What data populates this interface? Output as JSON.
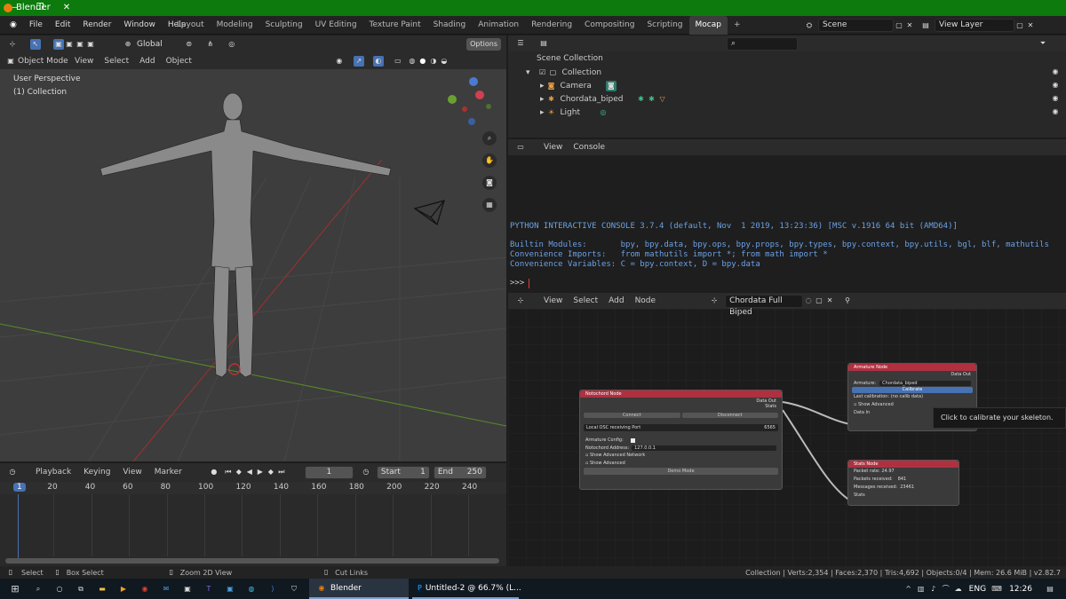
{
  "window": {
    "title": "Blender",
    "min": "—",
    "max": "❐",
    "close": "✕"
  },
  "menus": [
    "File",
    "Edit",
    "Render",
    "Window",
    "Help"
  ],
  "workspaces": [
    "Layout",
    "Modeling",
    "Sculpting",
    "UV Editing",
    "Texture Paint",
    "Shading",
    "Animation",
    "Rendering",
    "Compositing",
    "Scripting",
    "Mocap"
  ],
  "active_workspace": "Mocap",
  "scene": "Scene",
  "view_layer": "View Layer",
  "viewport": {
    "transform": "Global",
    "options": "Options",
    "mode": "Object Mode",
    "menus": [
      "View",
      "Select",
      "Add",
      "Object"
    ],
    "perspective": "User Perspective",
    "collection": "(1) Collection"
  },
  "outliner": {
    "root": "Scene Collection",
    "collection": "Collection",
    "items": [
      "Camera",
      "Chordata_biped",
      "Light"
    ]
  },
  "console": {
    "menus": [
      "View",
      "Console"
    ],
    "line1": "PYTHON INTERACTIVE CONSOLE 3.7.4 (default, Nov  1 2019, 13:23:36) [MSC v.1916 64 bit (AMD64)]",
    "line2": "Builtin Modules:       bpy, bpy.data, bpy.ops, bpy.props, bpy.types, bpy.context, bpy.utils, bgl, blf, mathutils",
    "line3": "Convenience Imports:   from mathutils import *; from math import *",
    "line4": "Convenience Variables: C = bpy.context, D = bpy.data",
    "prompt": ">>> "
  },
  "node_editor": {
    "menus": [
      "View",
      "Select",
      "Add",
      "Node"
    ],
    "tree": "Chordata Full Biped",
    "tooltip": "Click to calibrate your skeleton."
  },
  "notochord": {
    "title": "Notochord Node",
    "out1": "Data Out",
    "out2": "Stats",
    "connect": "Connect",
    "disconnect": "Disconnect",
    "port_label": "Local OSC receiving Port",
    "port": "6565",
    "armature_cfg": "Armature Config:",
    "addr_label": "Notochord Address:",
    "addr": "127.0.0.1",
    "adv_net": "Show Advanced Network",
    "adv": "Show Advanced",
    "demo": "Demo Mode"
  },
  "armature": {
    "title": "Armature Node",
    "out": "Data Out",
    "arm_label": "Armature:",
    "arm": "Chordata_biped",
    "calibrate": "Calibrate",
    "last": "Last calibration: (no calib data)",
    "adv": "Show Advanced",
    "in": "Data In"
  },
  "stats": {
    "title": "Stats Node",
    "rate": "Packet rate: 24.97",
    "received": "Packets received:",
    "received_v": "841",
    "msgs": "Messages received:",
    "msgs_v": "23461",
    "in": "Stats"
  },
  "timeline": {
    "menus": [
      "Playback",
      "Keying",
      "View",
      "Marker"
    ],
    "frame": "1",
    "start_label": "Start",
    "start": "1",
    "end_label": "End",
    "end": "250",
    "ticks": [
      "1",
      "20",
      "40",
      "60",
      "80",
      "100",
      "120",
      "140",
      "160",
      "180",
      "200",
      "220",
      "240"
    ]
  },
  "statusbar": {
    "select": "Select",
    "box": "Box Select",
    "zoom": "Zoom 2D View",
    "cut": "Cut Links",
    "info": "Collection | Verts:2,354 | Faces:2,370 | Tris:4,692 | Objects:0/4 | Mem: 26.6 MiB | v2.82.7"
  },
  "taskbar": {
    "app1": "Blender",
    "app2": "Untitled-2 @ 66.7% (L...",
    "lang": "ENG",
    "time": "12:26"
  }
}
